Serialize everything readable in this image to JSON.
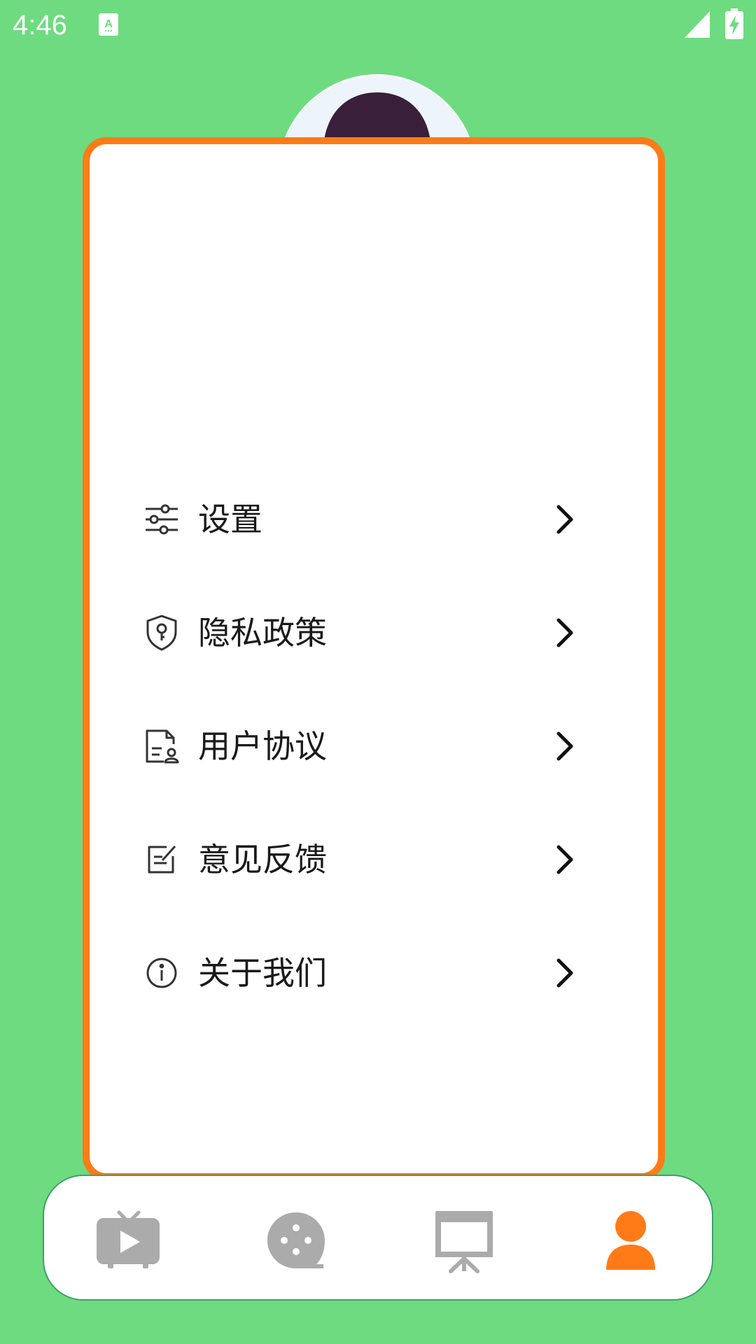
{
  "status_bar": {
    "time": "4:46",
    "icons": [
      "text-input-icon",
      "cellular-signal-icon",
      "battery-charging-icon"
    ]
  },
  "profile": {
    "avatar_icon": "boy-avatar-icon"
  },
  "menu": {
    "items": [
      {
        "id": "settings",
        "label": "设置",
        "icon": "sliders-icon"
      },
      {
        "id": "privacy",
        "label": "隐私政策",
        "icon": "shield-key-icon"
      },
      {
        "id": "agreement",
        "label": "用户协议",
        "icon": "document-user-icon"
      },
      {
        "id": "feedback",
        "label": "意见反馈",
        "icon": "edit-note-icon"
      },
      {
        "id": "about",
        "label": "关于我们",
        "icon": "info-icon"
      }
    ],
    "chevron_icon": "chevron-right-icon"
  },
  "bottom_nav": {
    "items": [
      {
        "id": "video",
        "icon": "tv-play-icon",
        "active": false
      },
      {
        "id": "chat",
        "icon": "chat-dots-icon",
        "active": false
      },
      {
        "id": "board",
        "icon": "presentation-board-icon",
        "active": false
      },
      {
        "id": "profile",
        "icon": "person-icon",
        "active": true
      }
    ]
  },
  "colors": {
    "background": "#6edb80",
    "accent": "#ff7b17",
    "card": "#ffffff",
    "nav_inactive": "#ababab",
    "nav_border": "#3d9f6a",
    "text": "#1a1a1a"
  }
}
